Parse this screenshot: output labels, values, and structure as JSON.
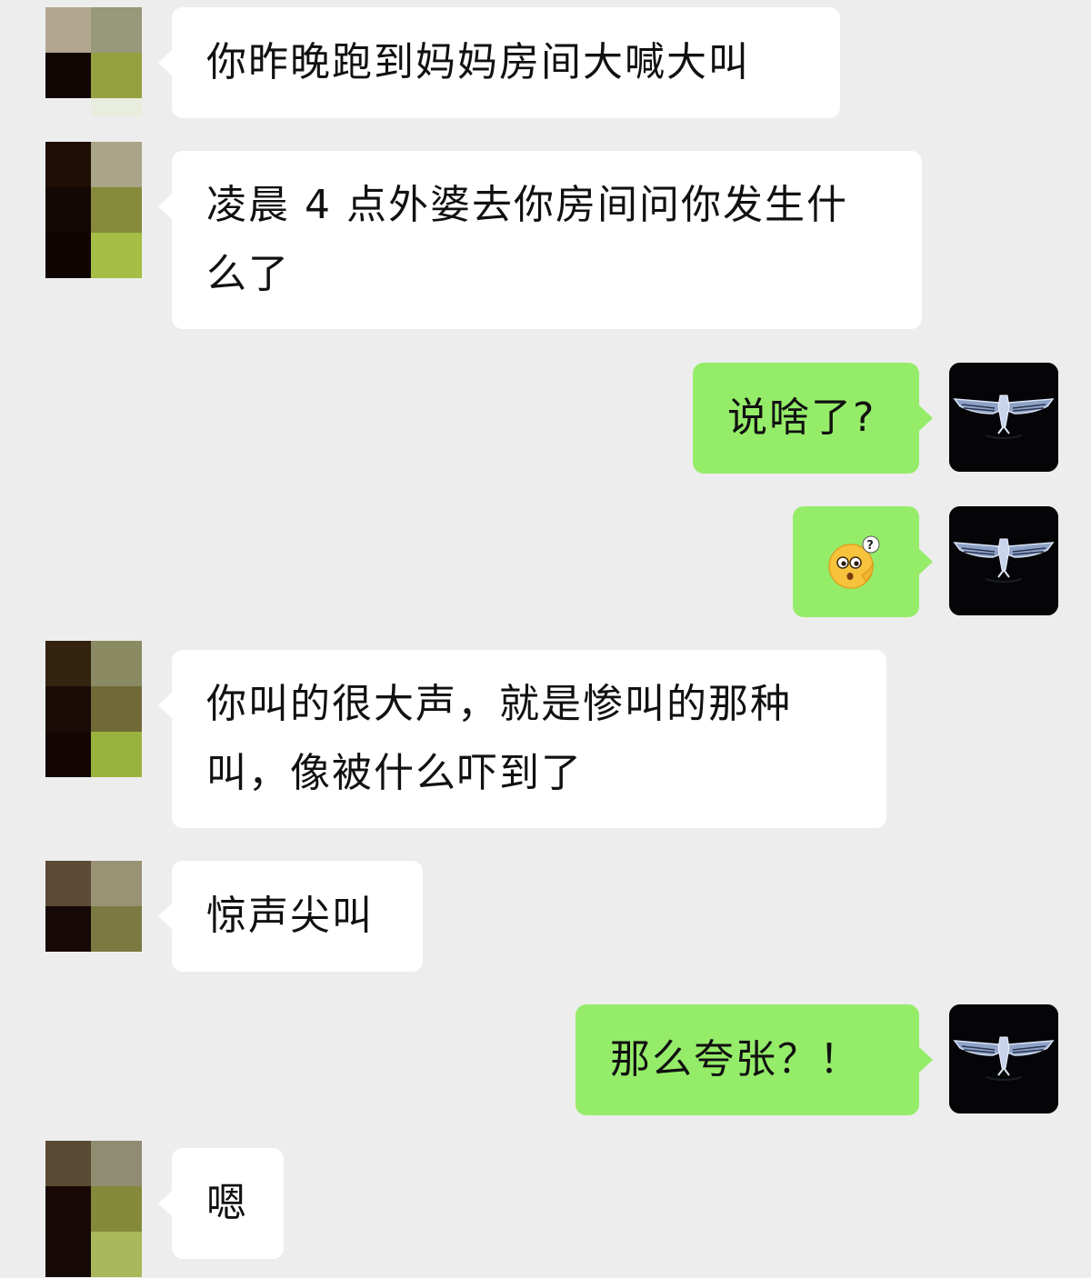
{
  "messages": [
    {
      "side": "in",
      "text": "你昨晚跑到妈妈房间大喊大叫"
    },
    {
      "side": "in",
      "text": "凌晨 4 点外婆去你房间问你发生什\n么了"
    },
    {
      "side": "out",
      "text": "说啥了?"
    },
    {
      "side": "out",
      "text": "",
      "sticker": "thinking-face-emoji"
    },
    {
      "side": "in",
      "text": "你叫的很大声，就是惨叫的那种\n叫，像被什么吓到了"
    },
    {
      "side": "in",
      "text": "惊声尖叫"
    },
    {
      "side": "out",
      "text": "那么夸张？！"
    },
    {
      "side": "in",
      "text": "嗯"
    }
  ],
  "colors": {
    "background": "#ededed",
    "incoming_bubble": "#ffffff",
    "outgoing_bubble": "#95ec69",
    "text": "#111111"
  },
  "icons": {
    "self_avatar": "winged-eagle-emblem-icon",
    "contact_avatar": "pixelated-photo-avatar"
  }
}
